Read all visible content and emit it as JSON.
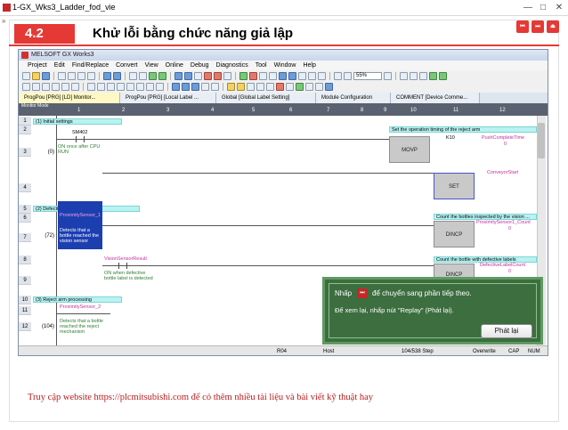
{
  "window": {
    "title": "1-GX_Wks3_Ladder_fod_vie",
    "controls": [
      "—",
      "□",
      "✕"
    ]
  },
  "slide": {
    "section_number": "4.2",
    "section_title": "Khử lỗi bằng chức năng giả lập",
    "nav_buttons": [
      "⏮",
      "⏭",
      "⏏"
    ]
  },
  "gxworks": {
    "title": "MELSOFT GX Works3",
    "menu": [
      "Project",
      "Edit",
      "Find/Replace",
      "Convert",
      "View",
      "Online",
      "Debug",
      "Diagnostics",
      "Tool",
      "Window",
      "Help"
    ],
    "zoom": "55%",
    "tabs": [
      "ProgPou [PRG] [LD] Monitor...",
      "ProgPou [PRG] [Local Label ...",
      "Global [Global Label Setting]",
      "Module Configuration",
      "COMMENT [Device Comme..."
    ],
    "ladder": {
      "mode_label": "Monitor Mode",
      "columns": [
        "1",
        "2",
        "3",
        "4",
        "5",
        "6",
        "7",
        "8",
        "9",
        "10",
        "11",
        "12"
      ],
      "rows": [
        "1",
        "2",
        "3",
        "4",
        "5",
        "6",
        "7",
        "8",
        "9",
        "10",
        "11",
        "12"
      ],
      "step_numbers": [
        "(0)",
        "(72)",
        "(104)"
      ],
      "comments": {
        "c1": "(1) Initial settings",
        "c1r": "Set the operation timing of the reject arm",
        "c2": "(2) Defective label processing",
        "c2r": "Count the bottles inspected by the vision ...",
        "c2r2": "Count the bottle with defective labels",
        "c3": "(3) Reject arm processing"
      },
      "devices": {
        "sm402": "SM402",
        "k10": "K10",
        "push_time": "PushCompleteTime",
        "conveyor_start": "ConveyorStart",
        "prox1": "ProximitySensor_1",
        "prox1_count": "ProximitySensor1_Count",
        "vision_result": "VisionSensorResult",
        "defective_count": "DefectiveLabelCount",
        "prox2": "ProximitySensor_2",
        "d0": "0",
        "d1": "0",
        "d2": "0"
      },
      "device_notes": {
        "n1": "ON once after CPU RUN",
        "n2": "Detects that a bottle reached the vision sensor",
        "n3": "ON when defective bottle label is detected",
        "n4": "Detects that a bottle reached the reject mechanism"
      },
      "instructions": [
        "MOVP",
        "SET",
        "DINCP",
        "DINCP"
      ]
    },
    "status": {
      "r04": "R04",
      "host": "Host",
      "steps": "104/538 Step",
      "overwrite": "Overwrite",
      "cap": "CAP",
      "num": "NUM"
    }
  },
  "popup": {
    "line1_pre": "Nhấp",
    "icon": "⏭",
    "line1_post": "để chuyển sang phần tiếp theo.",
    "line2": "Để xem lại, nhấp nút \"Replay\" (Phát lại).",
    "button": "Phát lại"
  },
  "footer": "Truy cập website https://plcmitsubishi.com để có thêm nhiều tài liệu và bài viết kỹ thuật hay"
}
